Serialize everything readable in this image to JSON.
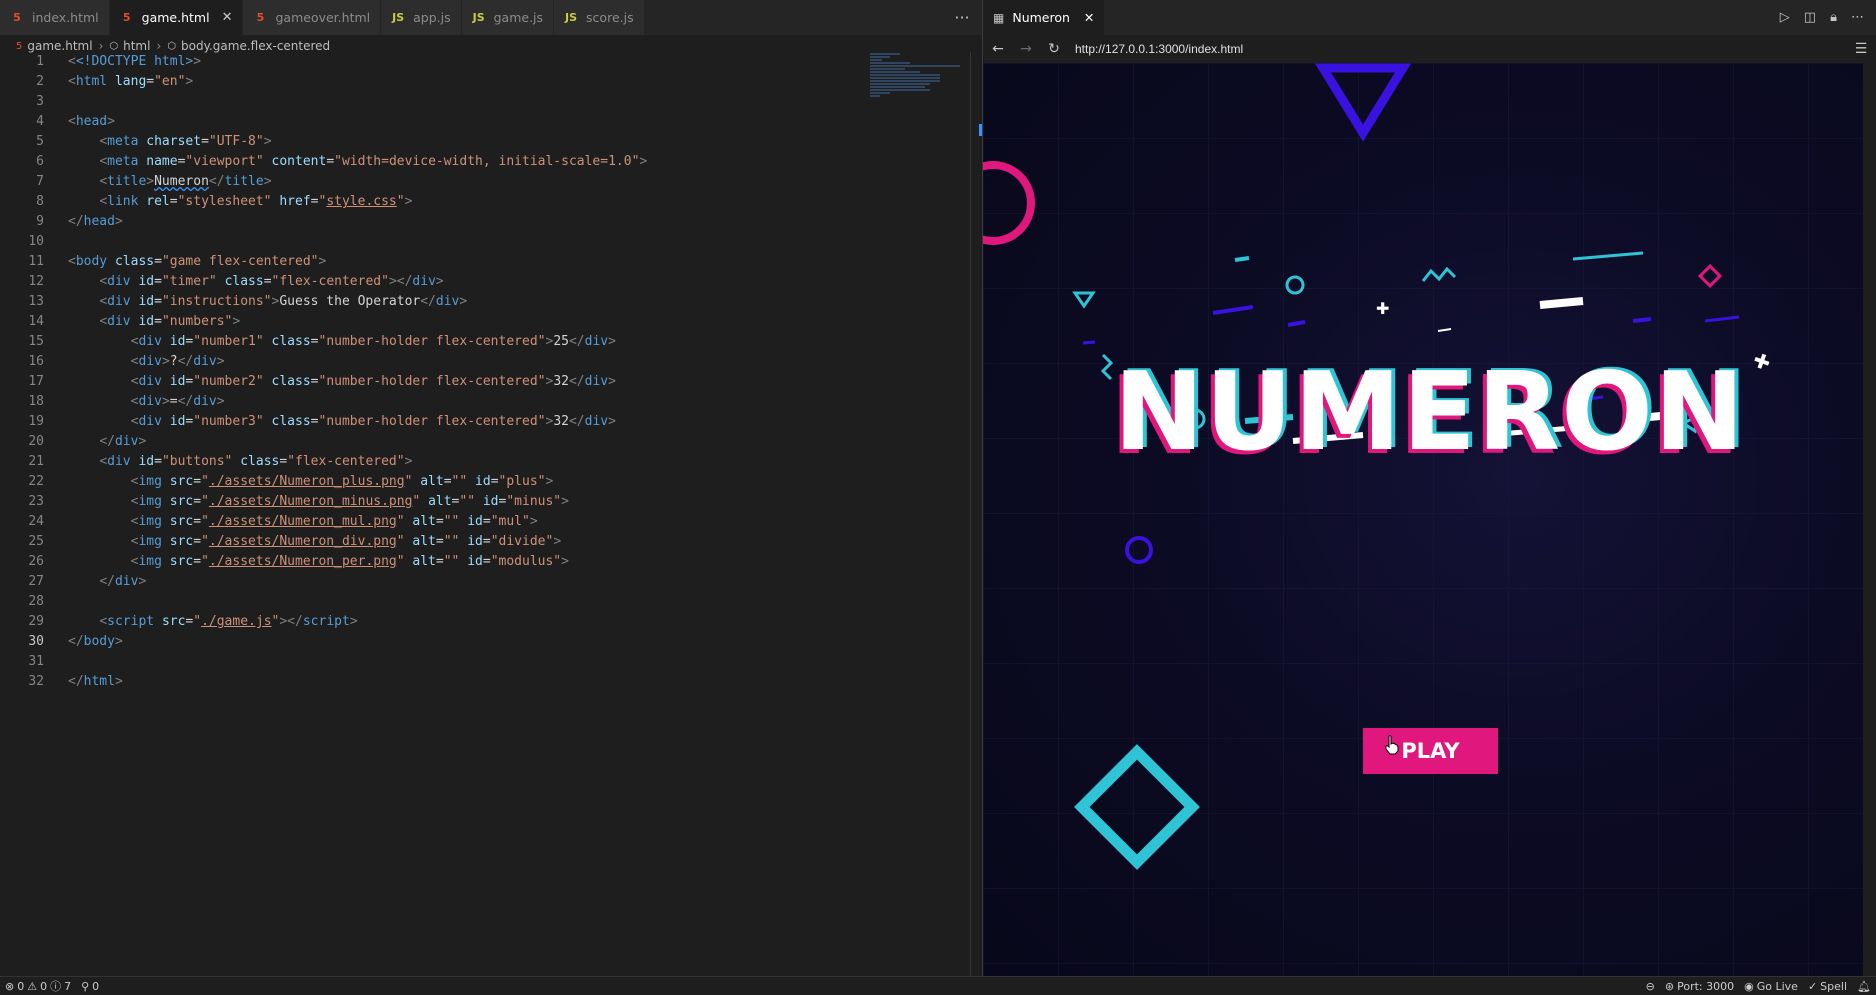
{
  "editor": {
    "tabs": [
      {
        "label": "index.html",
        "icon": "html-file-icon",
        "active": false
      },
      {
        "label": "game.html",
        "icon": "html-file-icon",
        "active": true
      },
      {
        "label": "gameover.html",
        "icon": "html-file-icon",
        "active": false
      },
      {
        "label": "app.js",
        "icon": "js-file-icon",
        "active": false
      },
      {
        "label": "game.js",
        "icon": "js-file-icon",
        "active": false
      },
      {
        "label": "score.js",
        "icon": "js-file-icon",
        "active": false
      }
    ],
    "more_label": "···",
    "breadcrumb": [
      "game.html",
      "html",
      "body.game.flex-centered"
    ],
    "current_line": 30,
    "lines": [
      "1",
      "2",
      "3",
      "4",
      "5",
      "6",
      "7",
      "8",
      "9",
      "10",
      "11",
      "12",
      "13",
      "14",
      "15",
      "16",
      "17",
      "18",
      "19",
      "20",
      "21",
      "22",
      "23",
      "24",
      "25",
      "26",
      "27",
      "28",
      "29",
      "30",
      "31",
      "32"
    ],
    "code": {
      "doctype": "<!DOCTYPE html>",
      "lang": "\"en\"",
      "charset": "\"UTF-8\"",
      "viewport_content": "\"width=device-width, initial-scale=1.0\"",
      "title_text": "Numeron",
      "css_href": "style.css",
      "body_class": "\"game flex-centered\"",
      "timer_id": "\"timer\"",
      "flex_centered": "\"flex-centered\"",
      "instructions_id": "\"instructions\"",
      "instructions_text": "Guess the Operator",
      "numbers_id": "\"numbers\"",
      "number1_id": "\"number1\"",
      "number2_id": "\"number2\"",
      "number3_id": "\"number3\"",
      "number_holder_class": "\"number-holder flex-centered\"",
      "number1_val": "25",
      "number2_val": "32",
      "number3_val": "32",
      "q_mark": "?",
      "eq_mark": "=",
      "buttons_id": "\"buttons\"",
      "imgs": [
        {
          "src": "./assets/Numeron_plus.png",
          "id": "\"plus\""
        },
        {
          "src": "./assets/Numeron_minus.png",
          "id": "\"minus\""
        },
        {
          "src": "./assets/Numeron_mul.png",
          "id": "\"mul\""
        },
        {
          "src": "./assets/Numeron_div.png",
          "id": "\"divide\""
        },
        {
          "src": "./assets/Numeron_per.png",
          "id": "\"modulus\""
        }
      ],
      "script_src": "./game.js"
    }
  },
  "browser": {
    "tab_title": "Numeron",
    "url": "http://127.0.0.1:3000/index.html",
    "page": {
      "title": "NUMERON",
      "play_label": "PLAY",
      "colors": {
        "pink": "#e0187d",
        "cyan": "#2ec4d6",
        "violet": "#3a12e0",
        "bg": "#0c0b24"
      }
    }
  },
  "statusbar": {
    "errors": "0",
    "warnings": "0",
    "infos": "7",
    "ports": "0",
    "port": "Port: 3000",
    "go_live": "Go Live",
    "spell": "Spell"
  }
}
